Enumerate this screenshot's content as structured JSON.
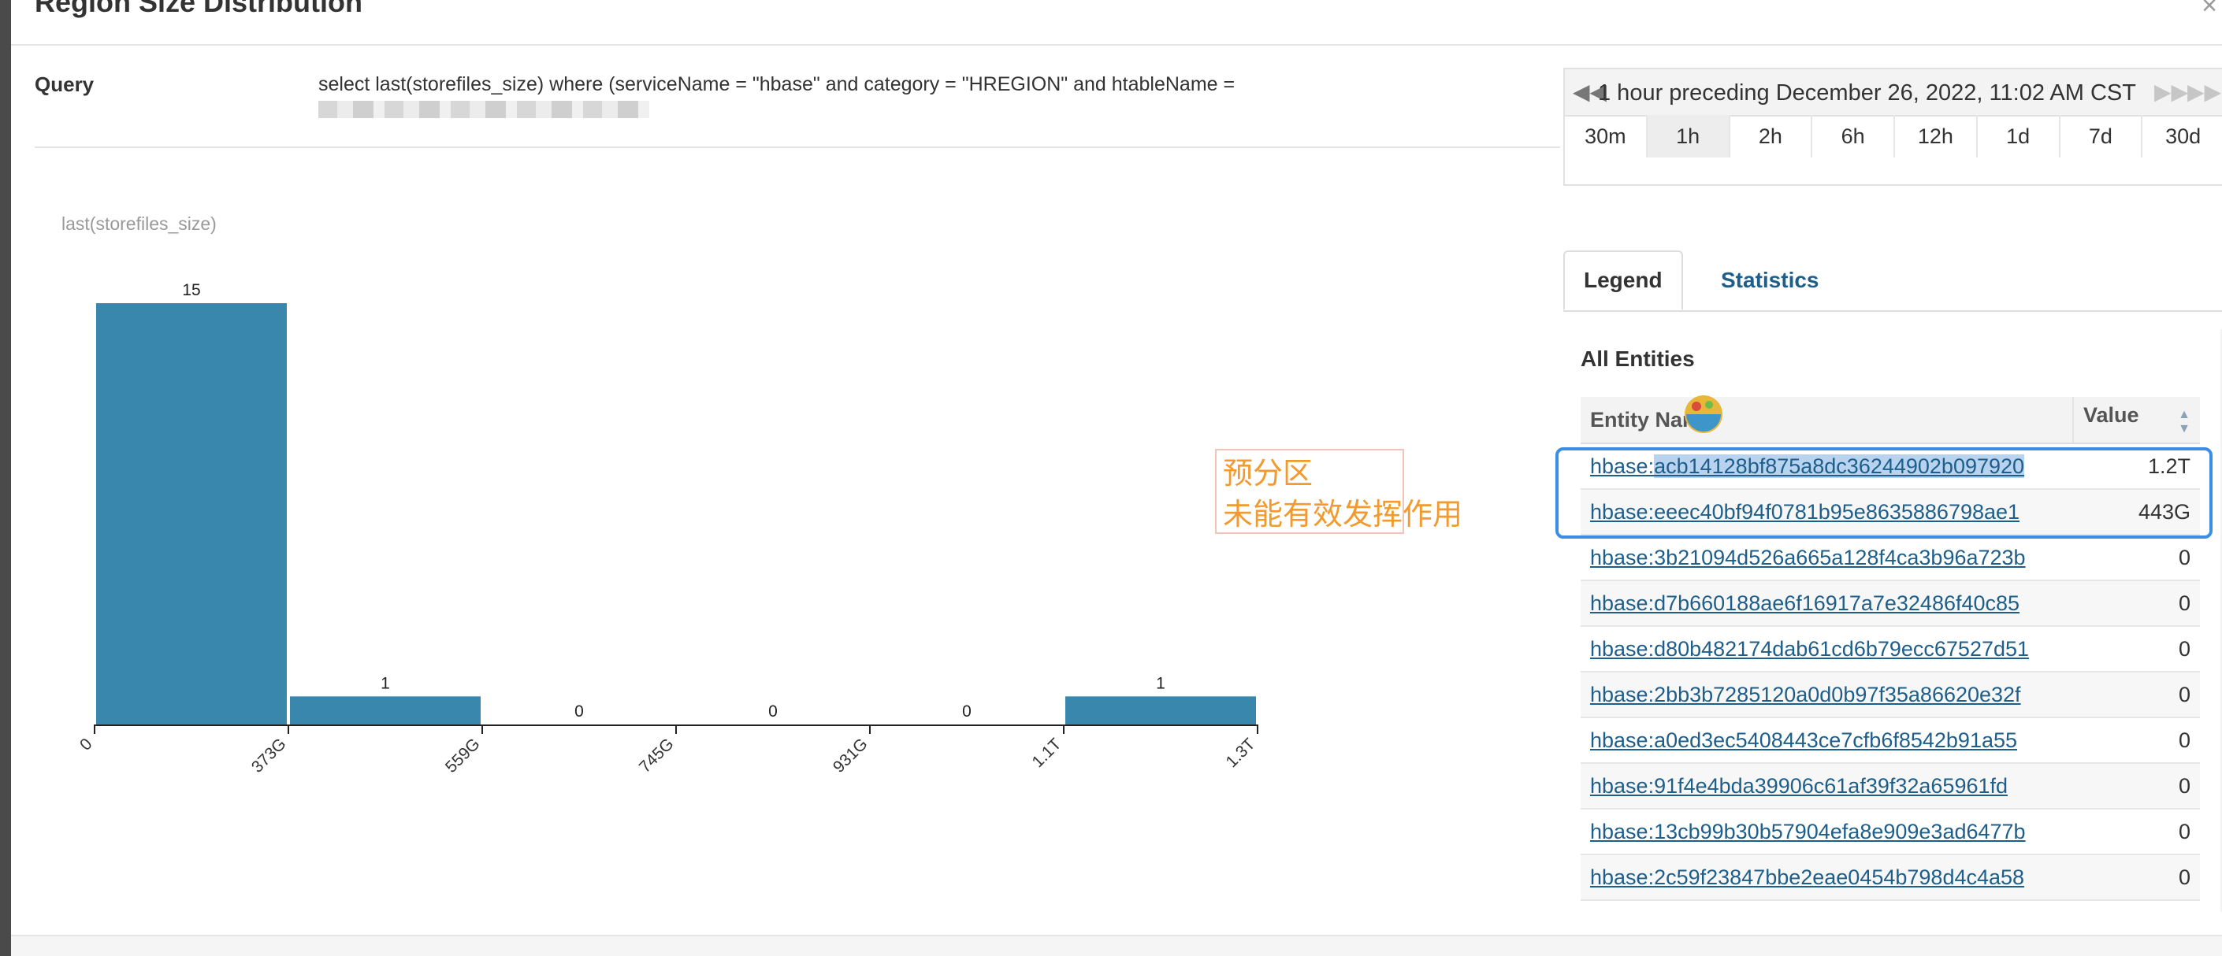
{
  "modal": {
    "title": "Region Size Distribution",
    "close_glyph": "×"
  },
  "query": {
    "label": "Query",
    "text": "select last(storefiles_size) where (serviceName = \"hbase\" and category = \"HREGION\" and htableName ="
  },
  "chart_data": {
    "type": "bar",
    "title": "last(storefiles_size)",
    "x_ticks": [
      "0",
      "373G",
      "559G",
      "745G",
      "931G",
      "1.1T",
      "1.3T"
    ],
    "bins": [
      {
        "from": "0",
        "to": "373G",
        "value": 15
      },
      {
        "from": "373G",
        "to": "559G",
        "value": 1
      },
      {
        "from": "559G",
        "to": "745G",
        "value": 0
      },
      {
        "from": "745G",
        "to": "931G",
        "value": 0
      },
      {
        "from": "931G",
        "to": "1.1T",
        "value": 0
      },
      {
        "from": "1.1T",
        "to": "1.3T",
        "value": 1
      }
    ],
    "color": "#3a87ad",
    "ylim": [
      0,
      15
    ]
  },
  "annotation": {
    "line1": "预分区",
    "line2": "未能有效发挥作用",
    "color": "#f29a2e"
  },
  "time_picker": {
    "label": "1 hour preceding December 26, 2022, 11:02 AM CST",
    "ranges": [
      "30m",
      "1h",
      "2h",
      "6h",
      "12h",
      "1d",
      "7d",
      "30d"
    ],
    "active": "1h"
  },
  "tabs": {
    "legend": "Legend",
    "statistics": "Statistics"
  },
  "entities": {
    "title": "All Entities",
    "col_name": "Entity Name",
    "col_value": "Value",
    "rows": [
      {
        "name": "hbase:acb14128bf875a8dc36244902b097920",
        "value": "1.2T"
      },
      {
        "name": "hbase:eeec40bf94f0781b95e8635886798ae1",
        "value": "443G"
      },
      {
        "name": "hbase:3b21094d526a665a128f4ca3b96a723b",
        "value": "0"
      },
      {
        "name": "hbase:d7b660188ae6f16917a7e32486f40c85",
        "value": "0"
      },
      {
        "name": "hbase:d80b482174dab61cd6b79ecc67527d51",
        "value": "0"
      },
      {
        "name": "hbase:2bb3b7285120a0d0b97f35a86620e32f",
        "value": "0"
      },
      {
        "name": "hbase:a0ed3ec5408443ce7cfb6f8542b91a55",
        "value": "0"
      },
      {
        "name": "hbase:91f4e4bda39906c61af39f32a65961fd",
        "value": "0"
      },
      {
        "name": "hbase:13cb99b30b57904efa8e909e3ad6477b",
        "value": "0"
      },
      {
        "name": "hbase:2c59f23847bbe2eae0454b798d4c4a58",
        "value": "0"
      }
    ]
  },
  "colors": {
    "accent": "#1d5e8a",
    "highlight_border": "#3b8ee6",
    "bar": "#3a87ad"
  }
}
